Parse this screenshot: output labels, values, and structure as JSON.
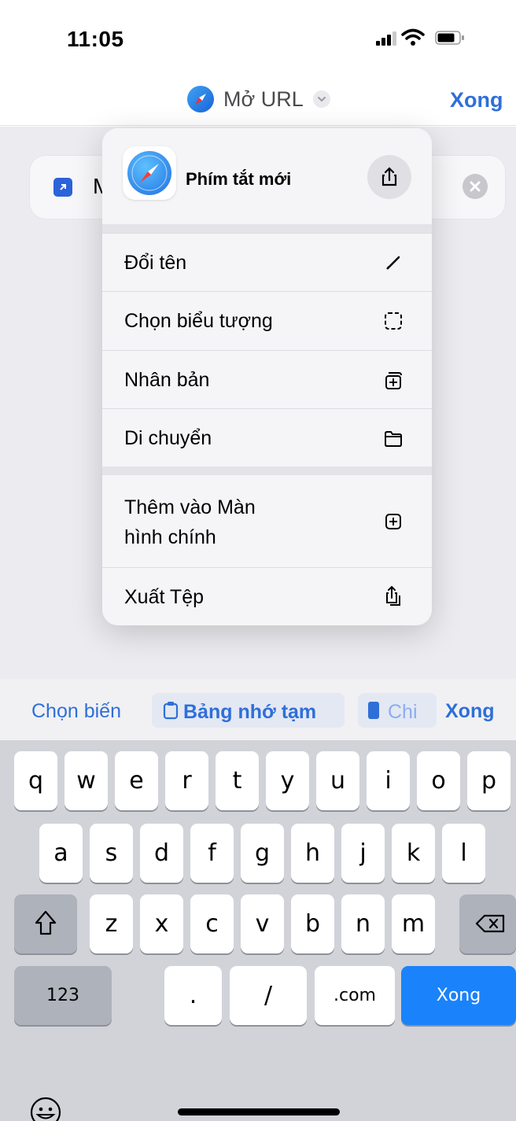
{
  "status_bar": {
    "time": "11:05"
  },
  "nav": {
    "title": "Mở URL",
    "done": "Xong"
  },
  "action_card": {
    "name": "M"
  },
  "menu": {
    "header_title": "Phím tắt mới",
    "items": [
      {
        "label": "Đổi tên",
        "icon": "pencil-icon"
      },
      {
        "label": "Chọn biểu tượng",
        "icon": "dashed-square-icon"
      },
      {
        "label": "Nhân bản",
        "icon": "duplicate-icon"
      },
      {
        "label": "Di chuyển",
        "icon": "folder-icon"
      },
      {
        "label_line1": "Thêm vào Màn",
        "label_line2": "hình chính",
        "icon": "plus-square-icon"
      },
      {
        "label": "Xuất Tệp",
        "icon": "export-icon"
      }
    ]
  },
  "toolbar": {
    "choose_variable": "Chọn biến",
    "clipboard": "Bảng nhớ tạm",
    "device": "Chi",
    "done": "Xong"
  },
  "keyboard": {
    "row1": [
      "q",
      "w",
      "e",
      "r",
      "t",
      "y",
      "u",
      "i",
      "o",
      "p"
    ],
    "row2": [
      "a",
      "s",
      "d",
      "f",
      "g",
      "h",
      "j",
      "k",
      "l"
    ],
    "row3": [
      "z",
      "x",
      "c",
      "v",
      "b",
      "n",
      "m"
    ],
    "numbers": "123",
    "dot": ".",
    "slash": "/",
    "dotcom": ".com",
    "go": "Xong"
  },
  "colors": {
    "accent": "#2f6fd8",
    "key_blue": "#1a82fb",
    "keyboard_bg": "#d1d3d9"
  }
}
